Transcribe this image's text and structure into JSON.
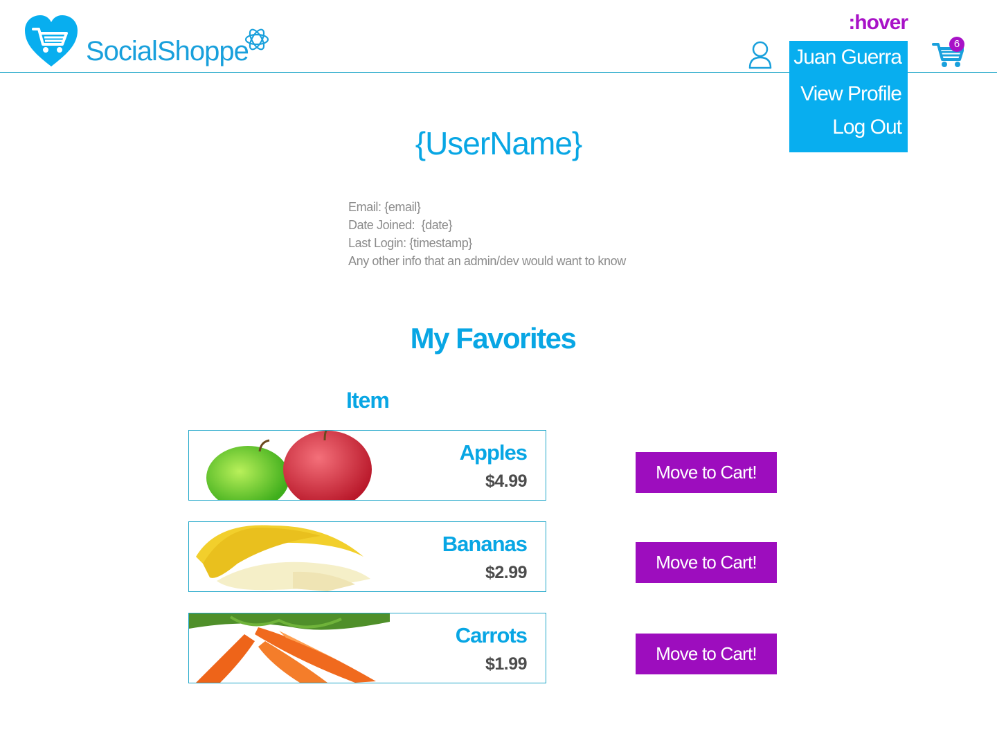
{
  "header": {
    "brand_part1": "Social",
    "brand_part2": "Shoppe",
    "hover_label": ":hover",
    "cart_count": "6",
    "dropdown": {
      "user_name": "Juan Guerra",
      "view_profile": "View Profile",
      "log_out": "Log Out"
    }
  },
  "profile": {
    "title": "{UserName}",
    "info_lines": [
      "Email: {email}",
      "Date Joined:  {date}",
      "Last Login: {timestamp}",
      "Any other info that an admin/dev would want to know"
    ]
  },
  "favorites": {
    "title": "My Favorites",
    "column_header": "Item",
    "items": [
      {
        "name": "Apples",
        "price": "$4.99",
        "button": "Move to Cart!"
      },
      {
        "name": "Bananas",
        "price": "$2.99",
        "button": "Move to Cart!"
      },
      {
        "name": "Carrots",
        "price": "$1.99",
        "button": "Move to Cart!"
      }
    ]
  },
  "colors": {
    "brand_blue": "#08aeef",
    "accent_purple": "#9d0dbe",
    "hover_purple": "#a812c7"
  },
  "icons": [
    "heart-cart-logo-icon",
    "redux-icon",
    "user-icon",
    "shopping-cart-icon"
  ]
}
